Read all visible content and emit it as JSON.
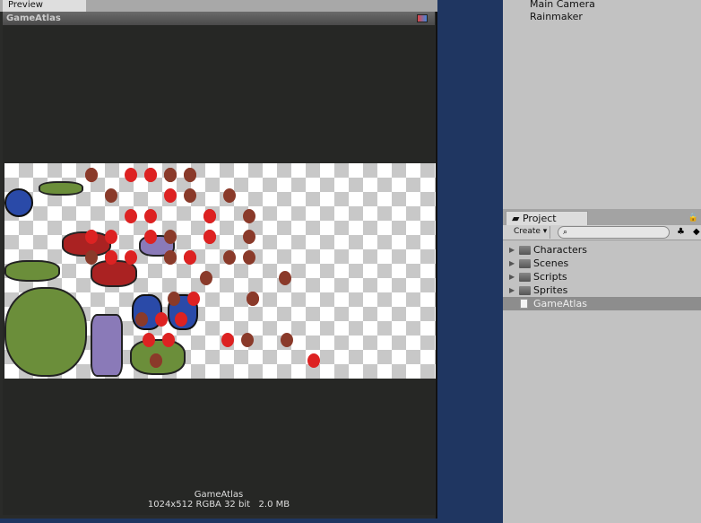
{
  "preview": {
    "tab": "Preview",
    "title": "GameAtlas",
    "info_name": "GameAtlas",
    "info_details": "1024x512 RGBA 32 bit   2.0 MB"
  },
  "hierarchy": {
    "items": [
      "Main Camera",
      "Rainmaker"
    ]
  },
  "project": {
    "tab": "Project",
    "create_label": "Create ▾",
    "search_placeholder": "",
    "items": [
      {
        "label": "Characters",
        "type": "folder"
      },
      {
        "label": "Scenes",
        "type": "folder"
      },
      {
        "label": "Scripts",
        "type": "folder"
      },
      {
        "label": "Sprites",
        "type": "folder"
      },
      {
        "label": "GameAtlas",
        "type": "file",
        "selected": true
      }
    ]
  },
  "colors": {
    "editor_bg": "#1f3661",
    "panel": "#c2c2c2",
    "preview_bg": "#262725",
    "selected": "#8d8d8d"
  }
}
